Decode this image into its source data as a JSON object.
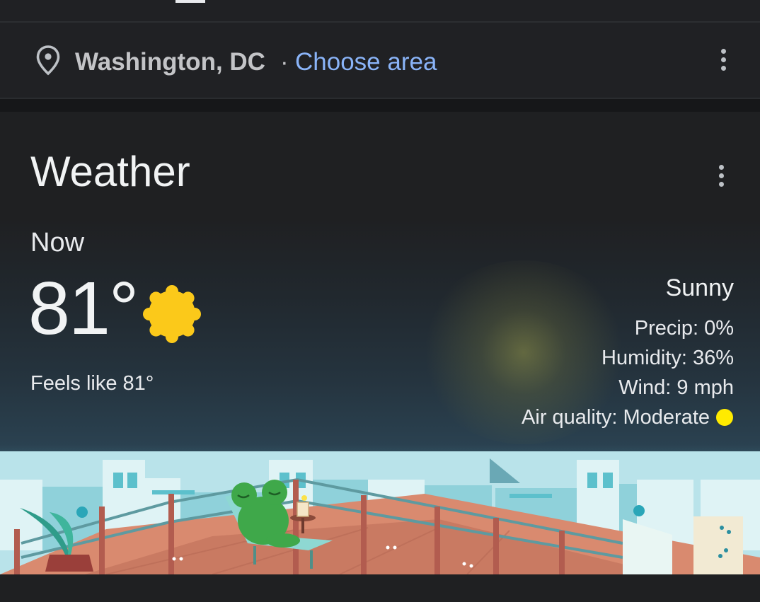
{
  "location": {
    "city": "Washington, DC",
    "separator": "·",
    "choose_area": "Choose area",
    "pin_icon": "location-pin-icon",
    "menu_icon": "more-vert-icon"
  },
  "weather": {
    "title": "Weather",
    "menu_icon": "more-vert-icon",
    "now_label": "Now",
    "temperature": "81°",
    "condition_icon": "sunny-icon",
    "feels_like": "Feels like 81°",
    "condition": "Sunny",
    "details": [
      {
        "label": "Precip:",
        "value": "0%"
      },
      {
        "label": "Humidity:",
        "value": "36%"
      },
      {
        "label": "Wind:",
        "value": "9 mph"
      },
      {
        "label": "Air quality:",
        "value": "Moderate"
      }
    ],
    "air_quality_color": "#ffeb00",
    "illustration": "frog-on-rooftop-deck-illustration"
  },
  "colors": {
    "background": "#1f2022",
    "link": "#8ab4f8",
    "sun": "#fbc91a"
  }
}
